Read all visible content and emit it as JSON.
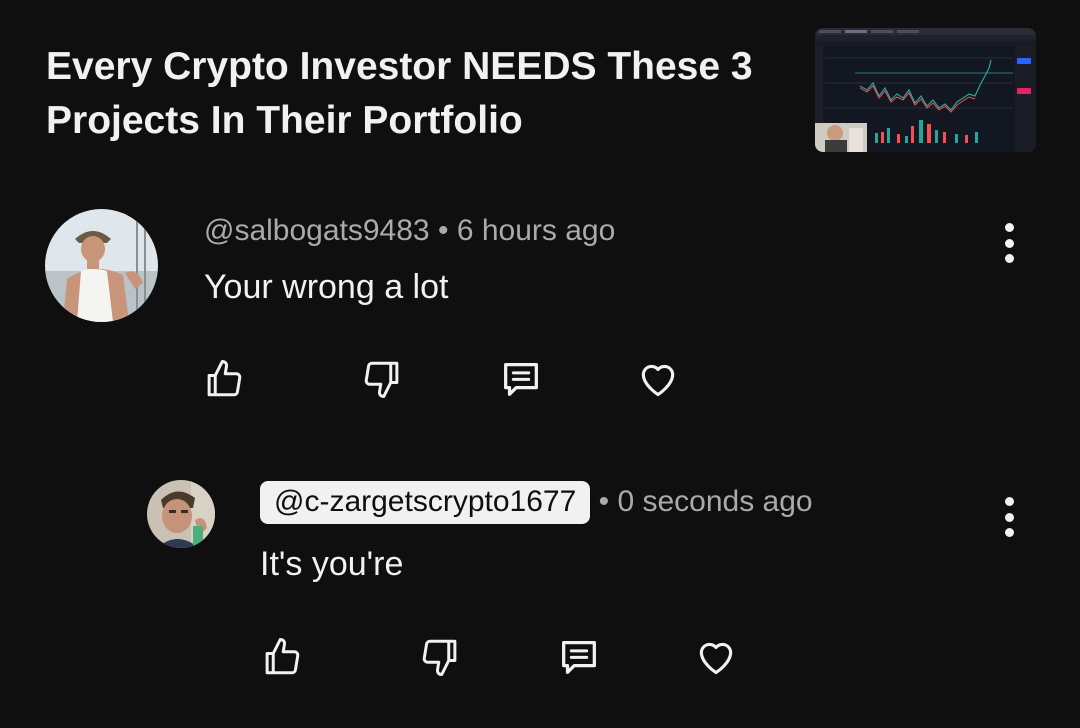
{
  "video": {
    "title": "Every Crypto Investor NEEDS These 3 Projects In Their Portfolio"
  },
  "comments": [
    {
      "handle": "@salbogats9483",
      "separator": "•",
      "time": "6 hours ago",
      "text": "Your wrong a lot"
    },
    {
      "handle": "@c-zargetscrypto1677",
      "separator": "•",
      "time": "0 seconds ago",
      "text": "It's you're"
    }
  ],
  "icons": {
    "like": "thumbs-up-icon",
    "dislike": "thumbs-down-icon",
    "reply": "reply-icon",
    "heart": "heart-icon",
    "more": "more-vertical-icon"
  },
  "colors": {
    "background": "#0f0f0f",
    "primary_text": "#f1f1f1",
    "secondary_text": "#aaaaaa",
    "chip_background": "#f1f1f1"
  }
}
